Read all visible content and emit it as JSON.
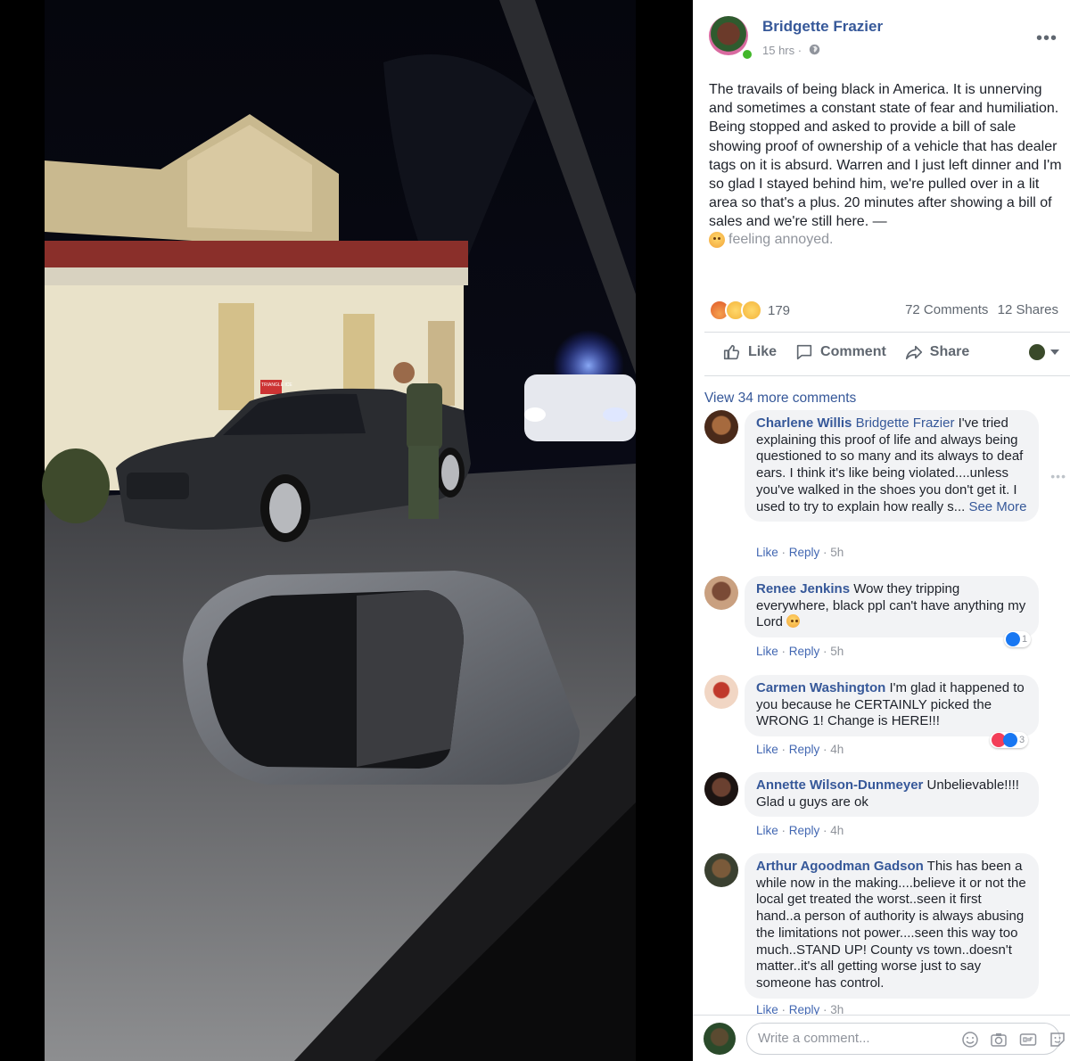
{
  "post": {
    "author": "Bridgette Frazier",
    "time": "15 hrs ·",
    "text": "The travails of being black in America. It is unnerving and sometimes a constant state of fear and humiliation. Being stopped and asked to provide a bill of sale showing proof of ownership of a vehicle that has dealer tags on it is absurd. Warren and I just left dinner and I'm so glad I stayed behind him, we're pulled over in a lit area so that's a plus. 20 minutes after showing a bill of sales and we're still here. —",
    "feeling": "feeling annoyed.",
    "reaction_count": "179",
    "comments_count": "72 Comments",
    "shares_count": "12 Shares"
  },
  "actions": {
    "like": "Like",
    "comment": "Comment",
    "share": "Share"
  },
  "comments_section": {
    "view_more": "View 34 more comments",
    "comments": [
      {
        "name": "Charlene Willis",
        "tag": "Bridgette Frazier",
        "text": " I've tried explaining this proof of life and always being questioned to so many and its always to deaf ears. I think it's like being violated....unless you've walked in the shoes you don't get it. I used to try to explain how really s... ",
        "see_more": "See More",
        "like": "Like",
        "reply": "Reply",
        "time": "5h"
      },
      {
        "name": "Renee Jenkins",
        "text": " Wow they tripping everywhere, black ppl can't have anything my Lord",
        "like": "Like",
        "reply": "Reply",
        "time": "5h",
        "reaction_count": "1"
      },
      {
        "name": "Carmen Washington",
        "text": " I'm glad it happened to you because he CERTAINLY picked the WRONG 1! Change is HERE!!!",
        "like": "Like",
        "reply": "Reply",
        "time": "4h",
        "reaction_count": "3"
      },
      {
        "name": "Annette Wilson-Dunmeyer",
        "text": " Unbelievable!!!! Glad u guys are ok",
        "like": "Like",
        "reply": "Reply",
        "time": "4h"
      },
      {
        "name": "Arthur Agoodman Gadson",
        "text": " This has been a while now in the making....believe it or not the local get treated the worst..seen it first hand..a person of authority is always abusing the limitations not power....seen this way too much..STAND UP! County vs town..doesn't matter..it's all getting worse just to say someone has control.",
        "like": "Like",
        "reply": "Reply",
        "time": "3h"
      }
    ]
  },
  "composer": {
    "placeholder": "Write a comment...",
    "icons": [
      "emoji-icon",
      "camera-icon",
      "gif-icon",
      "sticker-icon"
    ]
  },
  "photo": {
    "sign_text": "TRIANGLE ICE"
  },
  "colors": {
    "link": "#365899",
    "meta": "#90949c",
    "bubble": "#f2f3f5",
    "online": "#42b72a"
  }
}
